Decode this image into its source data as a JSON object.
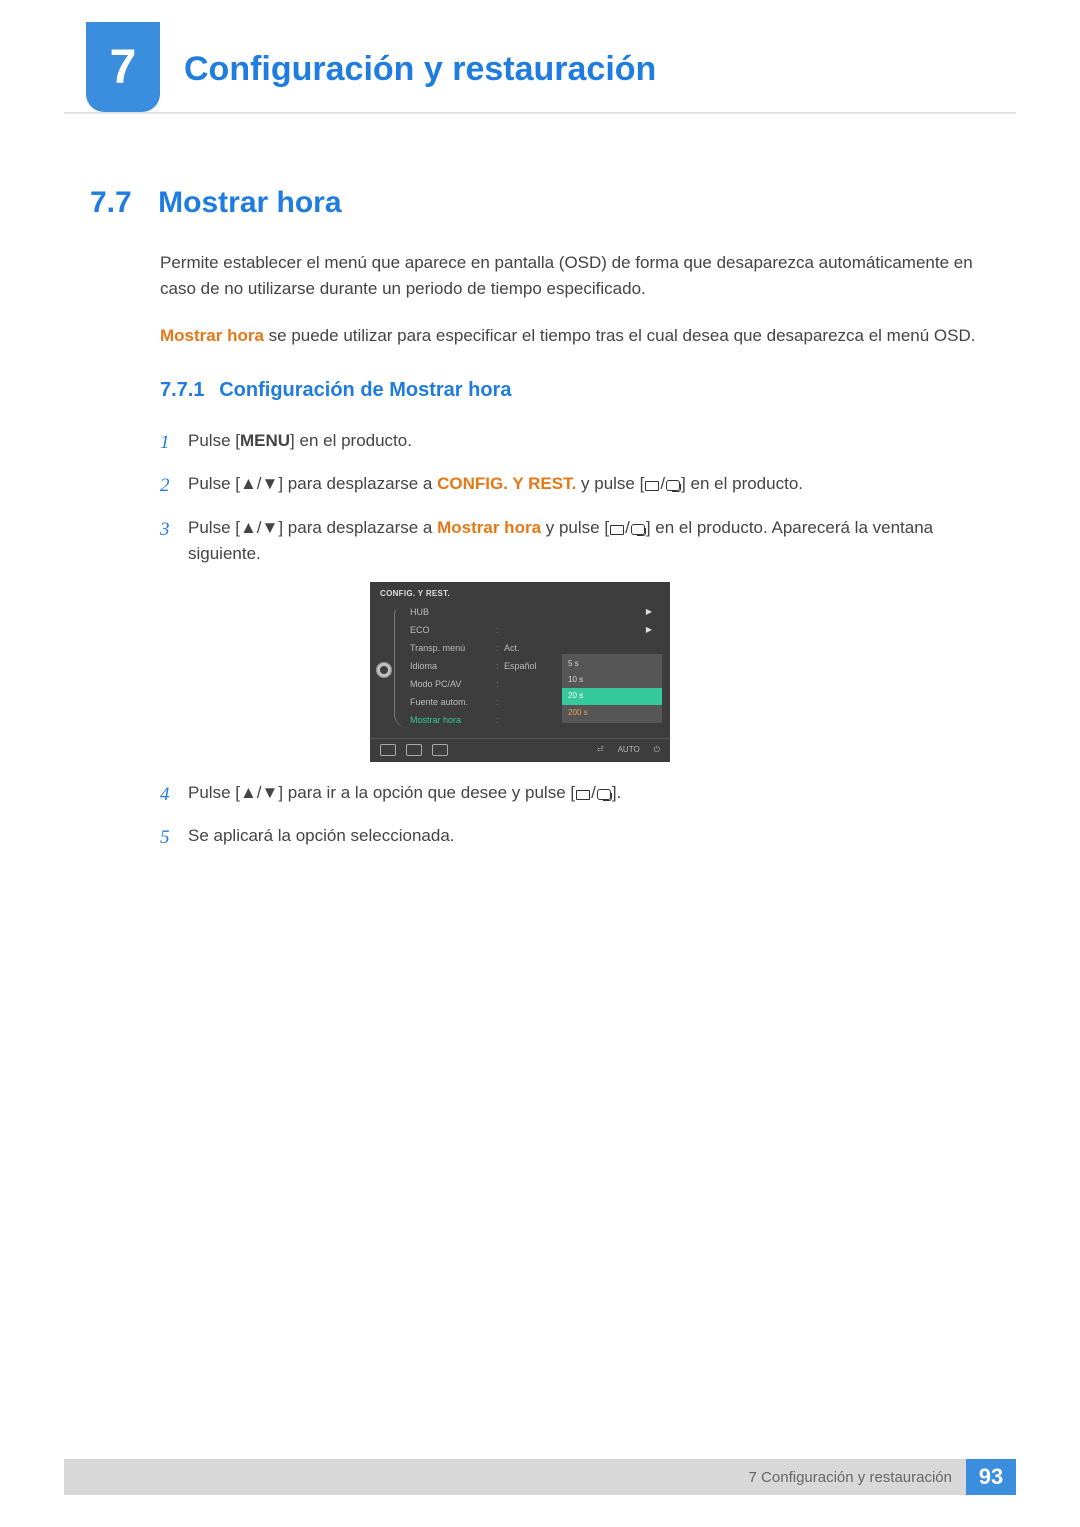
{
  "header": {
    "chapter_number": "7",
    "chapter_title": "Configuración y restauración"
  },
  "section": {
    "number": "7.7",
    "title": "Mostrar hora"
  },
  "intro": {
    "p1": "Permite establecer el menú que aparece en pantalla (OSD) de forma que desaparezca automáticamente en caso de no utilizarse durante un periodo de tiempo especificado.",
    "p2_bold": "Mostrar hora",
    "p2_rest": " se puede utilizar para especificar el tiempo tras el cual desea que desaparezca el menú OSD."
  },
  "subsection": {
    "number": "7.7.1",
    "title": "Configuración de Mostrar hora"
  },
  "steps": {
    "s1_a": "Pulse [",
    "s1_menu": "MENU",
    "s1_b": "] en el producto.",
    "s2_a": "Pulse [▲/▼] para desplazarse a ",
    "s2_bold": "CONFIG. Y REST.",
    "s2_b": " y pulse [",
    "s2_c": "] en el producto.",
    "s3_a": "Pulse [▲/▼] para desplazarse a ",
    "s3_bold": "Mostrar hora",
    "s3_b": " y pulse [",
    "s3_c": "] en el producto. Aparecerá la ventana siguiente.",
    "s4_a": "Pulse [▲/▼] para ir a la opción que desee y pulse [",
    "s4_b": "].",
    "s5": "Se aplicará la opción seleccionada."
  },
  "osd": {
    "title": "CONFIG. Y REST.",
    "rows": [
      {
        "label": "HUB",
        "val": "",
        "arrow": true
      },
      {
        "label": "ECO",
        "val": "",
        "arrow": true
      },
      {
        "label": "Transp. menú",
        "val": "Act."
      },
      {
        "label": "Idioma",
        "val": "Español"
      },
      {
        "label": "Modo PC/AV",
        "val": ""
      },
      {
        "label": "Fuente autom.",
        "val": ""
      },
      {
        "label": "Mostrar hora",
        "val": "",
        "green": true
      }
    ],
    "submenu": [
      "5 s",
      "10 s",
      "20 s",
      "200 s"
    ],
    "submenu_highlight_index": 2,
    "bottom_auto": "AUTO"
  },
  "footer": {
    "text": "7 Configuración y restauración",
    "page": "93"
  }
}
